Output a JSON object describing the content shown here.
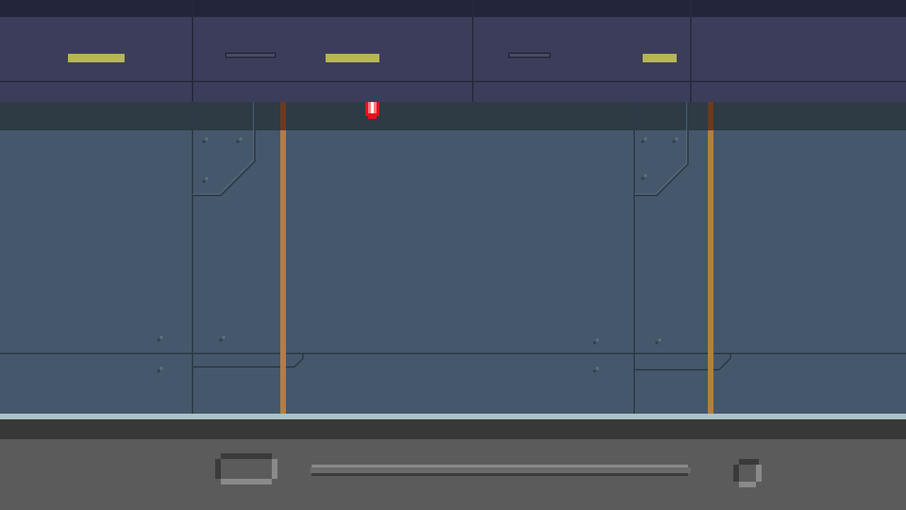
{
  "scene": {
    "name": "sci-fi corridor",
    "colors": {
      "ceiling": "#3c3d5a",
      "wall": "#45576a",
      "pipe": "#b37f3e",
      "light": "#b7b656",
      "marker": "#e0141c",
      "hud": "#5b5b5b"
    }
  },
  "hud": {
    "battery_icon": "battery-icon",
    "health_bar_icon": "health-bar",
    "item_slot_icon": "item-slot-icon"
  }
}
